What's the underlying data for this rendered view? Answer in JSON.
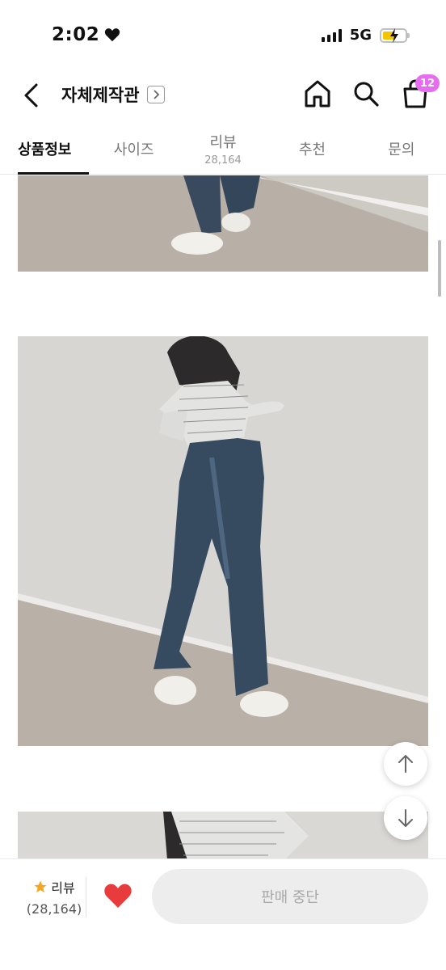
{
  "status": {
    "time": "2:02",
    "network": "5G"
  },
  "header": {
    "store_name": "자체제작관",
    "cart_count": "12"
  },
  "tabs": [
    {
      "label": "상품정보",
      "sub": ""
    },
    {
      "label": "사이즈",
      "sub": ""
    },
    {
      "label": "리뷰",
      "sub": "28,164"
    },
    {
      "label": "추천",
      "sub": ""
    },
    {
      "label": "문의",
      "sub": ""
    }
  ],
  "bottom": {
    "review_label": "리뷰",
    "review_count": "(28,164)",
    "action_label": "판매 중단"
  },
  "colors": {
    "accent_badge": "#e66cf0",
    "like": "#e83b3b",
    "star": "#f5a623"
  },
  "icons": [
    "heart-icon",
    "back-icon",
    "chevron-right-icon",
    "home-icon",
    "search-icon",
    "cart-icon",
    "arrow-up-icon",
    "arrow-down-icon",
    "star-icon"
  ]
}
